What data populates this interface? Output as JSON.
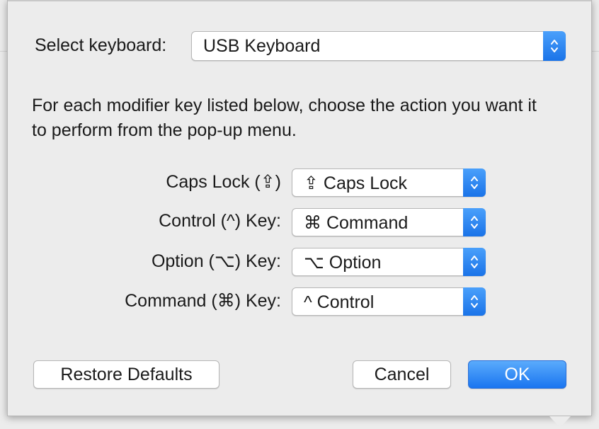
{
  "keyboard_selector": {
    "label": "Select keyboard:",
    "value": "USB Keyboard"
  },
  "instructions": "For each modifier key listed below, choose the action you want it to perform from the pop-up menu.",
  "modifier_rows": [
    {
      "key_label": "Caps Lock (⇪)",
      "action": "⇪ Caps Lock"
    },
    {
      "key_label": "Control (^) Key:",
      "action": "⌘ Command"
    },
    {
      "key_label": "Option (⌥) Key:",
      "action": "⌥ Option"
    },
    {
      "key_label": "Command (⌘) Key:",
      "action": "^ Control"
    }
  ],
  "buttons": {
    "restore_defaults": "Restore Defaults",
    "cancel": "Cancel",
    "ok": "OK"
  },
  "colors": {
    "accent": "#1a75f0",
    "sheet_background": "#ececec"
  },
  "icons": {
    "popup_stepper": "chevron-up-down-icon"
  }
}
